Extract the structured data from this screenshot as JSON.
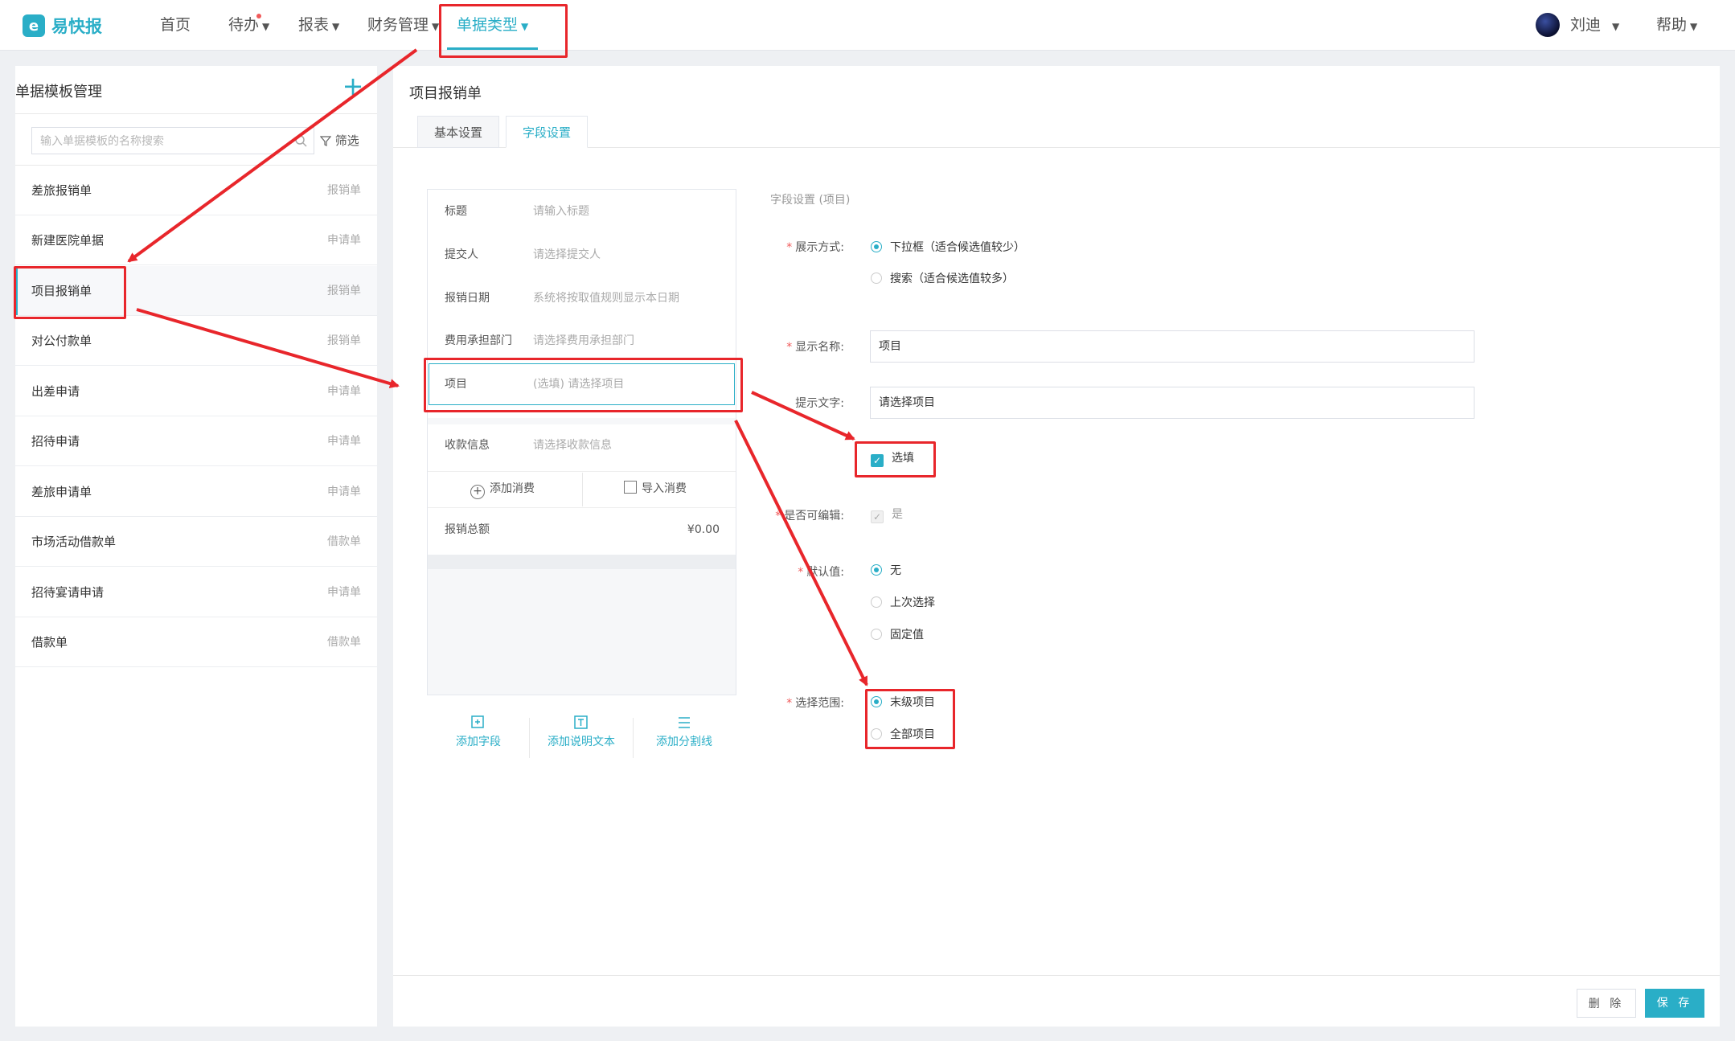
{
  "app": {
    "logo_text": "易快报",
    "logo_mark": "e"
  },
  "nav": {
    "home": "首页",
    "todo": "待办",
    "reports": "报表",
    "finance": "财务管理",
    "doc_types": "单据类型",
    "user_name": "刘迪",
    "help": "帮助"
  },
  "left": {
    "title": "单据模板管理",
    "search_placeholder": "输入单据模板的名称搜索",
    "filter_label": "筛选",
    "templates": [
      {
        "name": "差旅报销单",
        "type": "报销单"
      },
      {
        "name": "新建医院单据",
        "type": "申请单"
      },
      {
        "name": "项目报销单",
        "type": "报销单"
      },
      {
        "name": "对公付款单",
        "type": "报销单"
      },
      {
        "name": "出差申请",
        "type": "申请单"
      },
      {
        "name": "招待申请",
        "type": "申请单"
      },
      {
        "name": "差旅申请单",
        "type": "申请单"
      },
      {
        "name": "市场活动借款单",
        "type": "借款单"
      },
      {
        "name": "招待宴请申请",
        "type": "申请单"
      },
      {
        "name": "借款单",
        "type": "借款单"
      }
    ]
  },
  "right": {
    "title": "项目报销单",
    "tabs": [
      "基本设置",
      "字段设置"
    ],
    "preview": {
      "fields": [
        {
          "label": "标题",
          "value": "请输入标题"
        },
        {
          "label": "提交人",
          "value": "请选择提交人"
        },
        {
          "label": "报销日期",
          "value": "系统将按取值规则显示本日期"
        },
        {
          "label": "费用承担部门",
          "value": "请选择费用承担部门"
        },
        {
          "label": "项目",
          "value": "(选填) 请选择项目"
        }
      ],
      "payee": {
        "label": "收款信息",
        "value": "请选择收款信息"
      },
      "add_expense": "添加消费",
      "import_expense": "导入消费",
      "total": {
        "label": "报销总额",
        "value": "¥0.00"
      }
    },
    "tools": [
      "添加字段",
      "添加说明文本",
      "添加分割线"
    ],
    "settings": {
      "title": "字段设置 (项目)",
      "display_mode": {
        "label": "展示方式:",
        "options": [
          "下拉框（适合候选值较少）",
          "搜索（适合候选值较多）"
        ]
      },
      "display_name": {
        "label": "显示名称:",
        "value": "项目"
      },
      "hint_text": {
        "label": "提示文字:",
        "value": "请选择项目"
      },
      "optional": "选填",
      "editable": {
        "label": "是否可编辑:",
        "value": "是"
      },
      "default_value": {
        "label": "默认值:",
        "options": [
          "无",
          "上次选择",
          "固定值"
        ]
      },
      "scope": {
        "label": "选择范围:",
        "options": [
          "末级项目",
          "全部项目"
        ]
      }
    },
    "buttons": {
      "delete": "删 除",
      "save": "保 存"
    }
  },
  "colors": {
    "accent": "#2aaec7",
    "annotation": "#e8262b"
  }
}
